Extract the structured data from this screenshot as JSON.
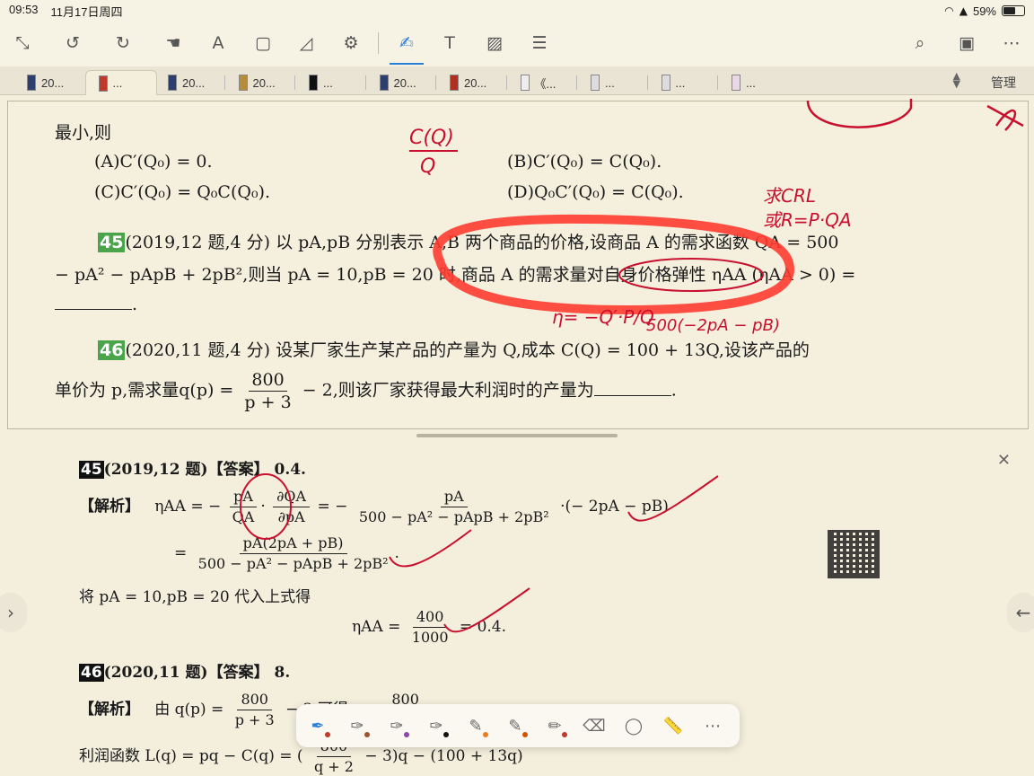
{
  "status": {
    "time": "09:53",
    "date": "11月17日周四",
    "battery": "59%",
    "battery_level": 0.59
  },
  "toolbar": {
    "items": [
      {
        "name": "collapse-icon",
        "glyph": "⤡"
      },
      {
        "name": "undo-icon",
        "glyph": "↺"
      },
      {
        "name": "redo-icon",
        "glyph": "↻"
      },
      {
        "name": "hand-icon",
        "glyph": "☚"
      },
      {
        "name": "text-highlight-icon",
        "glyph": "A"
      },
      {
        "name": "select-rect-icon",
        "glyph": "▢"
      },
      {
        "name": "lasso-icon",
        "glyph": "◿"
      },
      {
        "name": "settings-icon",
        "glyph": "⚙"
      },
      {
        "name": "pen-icon",
        "glyph": "✍"
      },
      {
        "name": "textbox-icon",
        "glyph": "T"
      },
      {
        "name": "image-icon",
        "glyph": "▨"
      },
      {
        "name": "list-icon",
        "glyph": "☰"
      },
      {
        "name": "search-icon",
        "glyph": "⌕"
      },
      {
        "name": "bookmark-icon",
        "glyph": "▣"
      },
      {
        "name": "more-icon",
        "glyph": "⋯"
      }
    ]
  },
  "tabs": [
    {
      "label": "20..."
    },
    {
      "label": "..."
    },
    {
      "label": "20..."
    },
    {
      "label": "20..."
    },
    {
      "label": "..."
    },
    {
      "label": "20..."
    },
    {
      "label": "20..."
    },
    {
      "label": "《..."
    },
    {
      "label": "..."
    },
    {
      "label": "..."
    },
    {
      "label": "..."
    }
  ],
  "tabs_manage": "管理",
  "problems": {
    "q44_tail": "最小,则",
    "q44_a": "(A)C′(Q₀) = 0.",
    "q44_b": "(B)C′(Q₀) = C(Q₀).",
    "q44_c": "(C)C′(Q₀) = Q₀C(Q₀).",
    "q44_d": "(D)Q₀C′(Q₀) = C(Q₀).",
    "q45_num": "45",
    "q45_line1": "(2019,12 题,4 分) 以 pA,pB 分别表示 A,B 两个商品的价格,设商品 A 的需求函数 QA = 500",
    "q45_line2": "− pA² − pApB + 2pB²,则当 pA = 10,pB = 20 时,商品 A 的需求量对自身价格弹性 ηAA (ηAA > 0) =",
    "q45_end": ".",
    "q46_num": "46",
    "q46_line1": "(2020,11 题,4 分) 设某厂家生产某产品的产量为 Q,成本 C(Q) = 100 + 13Q,设该产品的",
    "q46_line2a": "单价为 p,需求量q(p) =",
    "q46_frac_num": "800",
    "q46_frac_den": "p + 3",
    "q46_line2b": "− 2,则该厂家获得最大利润时的产量为",
    "q46_end": "."
  },
  "answers": {
    "a45_num": "45",
    "a45_head": "(2019,12 题)【答案】 0.4.",
    "a45_label": "【解析】",
    "a45_eta": "ηAA = −",
    "a45_f1n": "pA",
    "a45_f1d": "QA",
    "a45_f2n": "∂QA",
    "a45_f2d": "∂pA",
    "a45_eq": "= −",
    "a45_f3n": "pA",
    "a45_f3d": "500 − pA² − pApB + 2pB²",
    "a45_tail": "·(− 2pA − pB)",
    "a45_l2eq": "=",
    "a45_f4n": "pA(2pA + pB)",
    "a45_f4d": "500 − pA² − pApB + 2pB²",
    "a45_l2tail": ".",
    "a45_sub": "将 pA = 10,pB = 20 代入上式得",
    "a45_res_eta": "ηAA =",
    "a45_f5n": "400",
    "a45_f5d": "1000",
    "a45_res_tail": "= 0.4.",
    "a46_num": "46",
    "a46_head": "(2020,11 题)【答案】 8.",
    "a46_label": "【解析】",
    "a46_by": "由 q(p) =",
    "a46_f1n": "800",
    "a46_f1d": "p + 3",
    "a46_tail": "− 2,可得 p =",
    "a46_f2n": "800",
    "a46_profit": "利润函数 L(q) = pq − C(q) = (",
    "a46_f3n": "800",
    "a46_f3d": "q + 2",
    "a46_profit_tail": "− 3)q − (100 + 13q)"
  },
  "handwriting": {
    "note1": "C(Q)",
    "note2": "Q",
    "note3": "求CRL",
    "note4": "或R=P·QA",
    "note5": "η= −Q′·P/Q",
    "note6": "500(−2pA − pB)"
  },
  "palette": {
    "tools": [
      {
        "name": "fountain-pen-icon",
        "glyph": "✒",
        "color": "#c0392b"
      },
      {
        "name": "pen-brown-icon",
        "glyph": "✑",
        "color": "#a0522d"
      },
      {
        "name": "pen-purple-icon",
        "glyph": "✑",
        "color": "#8e44ad"
      },
      {
        "name": "pen-black-icon",
        "glyph": "✑",
        "color": "#111111"
      },
      {
        "name": "highlighter-icon",
        "glyph": "✎",
        "color": "#e67e22"
      },
      {
        "name": "highlighter-2-icon",
        "glyph": "✎",
        "color": "#d35400"
      },
      {
        "name": "pencil-icon",
        "glyph": "✏",
        "color": "#c0392b"
      },
      {
        "name": "eraser-icon",
        "glyph": "⌫",
        "color": ""
      },
      {
        "name": "lasso-select-icon",
        "glyph": "◯",
        "color": ""
      },
      {
        "name": "ruler-icon",
        "glyph": "📏",
        "color": ""
      },
      {
        "name": "more-tools-icon",
        "glyph": "⋯",
        "color": ""
      }
    ]
  },
  "colors": {
    "accent": "#2b7fd6",
    "ink": "#c8102e",
    "highlight": "#ff3b30",
    "qnum_green": "#4aa44a"
  }
}
